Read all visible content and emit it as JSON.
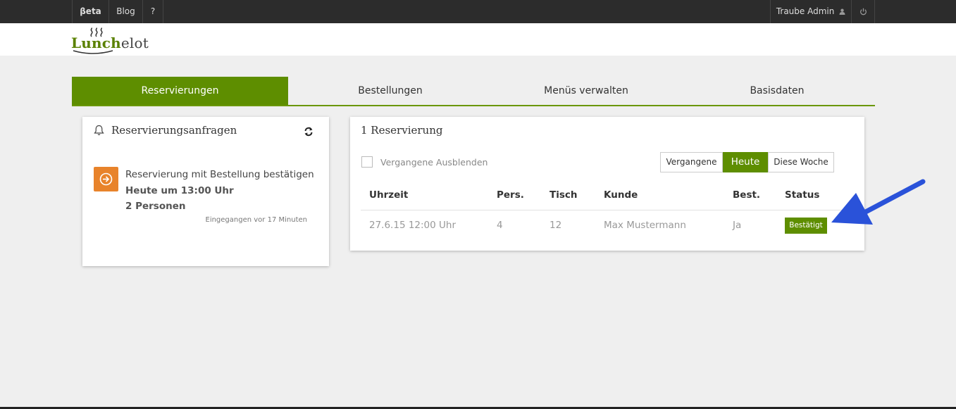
{
  "topbar": {
    "beta": "βeta",
    "blog": "Blog",
    "help": "?",
    "user": "Traube Admin",
    "user_icon": "user-icon",
    "power_icon": "power-icon"
  },
  "logo": {
    "lunch": "Lunch",
    "elot": "elot"
  },
  "tabs": [
    {
      "label": "Reservierungen",
      "active": true
    },
    {
      "label": "Bestellungen"
    },
    {
      "label": "Menüs verwalten"
    },
    {
      "label": "Basisdaten"
    }
  ],
  "requests": {
    "title": "Reservierungsanfragen",
    "item": {
      "line1": "Reservierung mit Bestellung bestätigen",
      "line2": "Heute um 13:00 Uhr",
      "line3": "2 Personen",
      "received": "Eingegangen vor 17 Minuten"
    }
  },
  "reservations": {
    "title": "1 Reservierung",
    "hide_past_label": "Vergangene Ausblenden",
    "filters": [
      "Vergangene",
      "Heute",
      "Diese Woche"
    ],
    "active_filter": "Heute",
    "columns": [
      "Uhrzeit",
      "Pers.",
      "Tisch",
      "Kunde",
      "Best.",
      "Status"
    ],
    "rows": [
      {
        "time": "27.6.15 12:00 Uhr",
        "persons": "4",
        "table": "12",
        "customer": "Max Mustermann",
        "order": "Ja",
        "status": "Bestätigt"
      }
    ]
  },
  "colors": {
    "accent": "#5e8e00",
    "orange": "#e8832b",
    "arrow": "#2a52d9",
    "topbar": "#2c2c2c"
  }
}
